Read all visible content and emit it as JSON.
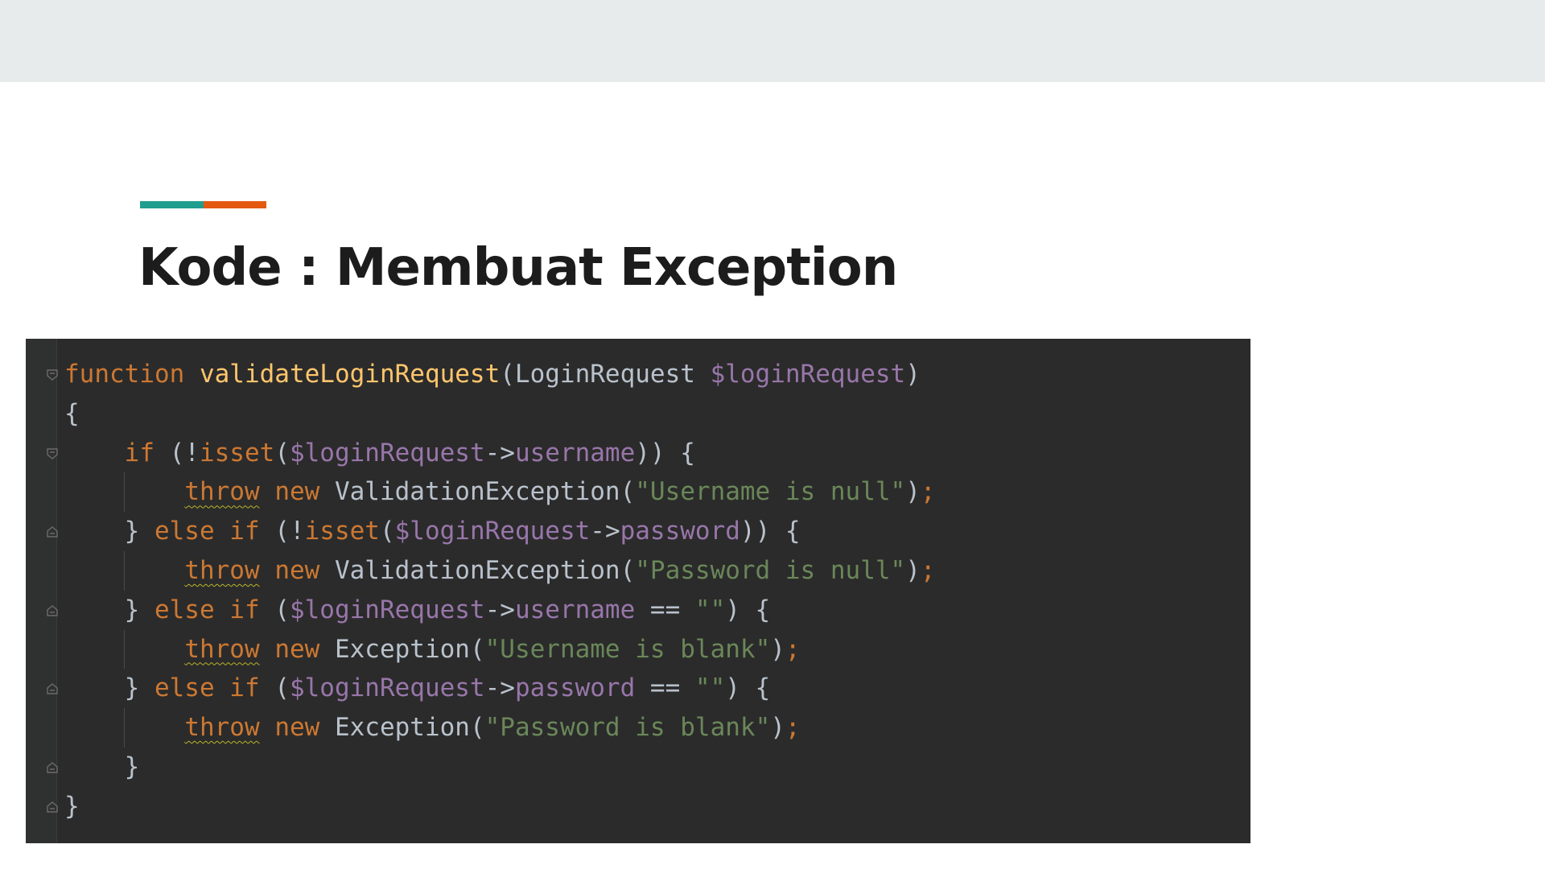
{
  "slide": {
    "title": "Kode : Membuat Exception",
    "accent_colors": [
      "#1f9e8f",
      "#e35a0f"
    ]
  },
  "code_panel": {
    "language": "php",
    "theme_colors": {
      "background": "#2b2b2b",
      "keyword": "#cc7832",
      "function_name": "#ffc66d",
      "variable": "#9876aa",
      "string": "#6a8759",
      "text": "#b9c2cc"
    },
    "lines": [
      [
        {
          "t": "function",
          "c": "kw"
        },
        {
          "t": " ",
          "c": "plain"
        },
        {
          "t": "validateLoginRequest",
          "c": "fn"
        },
        {
          "t": "(LoginRequest ",
          "c": "plain"
        },
        {
          "t": "$loginRequest",
          "c": "var"
        },
        {
          "t": ")",
          "c": "plain"
        }
      ],
      [
        {
          "t": "{",
          "c": "plain"
        }
      ],
      [
        {
          "t": "    ",
          "c": "plain"
        },
        {
          "t": "if",
          "c": "kw"
        },
        {
          "t": " (!",
          "c": "plain"
        },
        {
          "t": "isset",
          "c": "kw"
        },
        {
          "t": "(",
          "c": "plain"
        },
        {
          "t": "$loginRequest",
          "c": "var"
        },
        {
          "t": "->",
          "c": "plain"
        },
        {
          "t": "username",
          "c": "var"
        },
        {
          "t": ")) {",
          "c": "plain"
        }
      ],
      [
        {
          "t": "        ",
          "c": "plain"
        },
        {
          "t": "throw",
          "c": "throw"
        },
        {
          "t": " ",
          "c": "plain"
        },
        {
          "t": "new",
          "c": "kw"
        },
        {
          "t": " ValidationException(",
          "c": "plain"
        },
        {
          "t": "\"Username is null\"",
          "c": "str"
        },
        {
          "t": ")",
          "c": "plain"
        },
        {
          "t": ";",
          "c": "semi"
        }
      ],
      [
        {
          "t": "    } ",
          "c": "plain"
        },
        {
          "t": "else if",
          "c": "kw"
        },
        {
          "t": " (!",
          "c": "plain"
        },
        {
          "t": "isset",
          "c": "kw"
        },
        {
          "t": "(",
          "c": "plain"
        },
        {
          "t": "$loginRequest",
          "c": "var"
        },
        {
          "t": "->",
          "c": "plain"
        },
        {
          "t": "password",
          "c": "var"
        },
        {
          "t": ")) {",
          "c": "plain"
        }
      ],
      [
        {
          "t": "        ",
          "c": "plain"
        },
        {
          "t": "throw",
          "c": "throw"
        },
        {
          "t": " ",
          "c": "plain"
        },
        {
          "t": "new",
          "c": "kw"
        },
        {
          "t": " ValidationException(",
          "c": "plain"
        },
        {
          "t": "\"Password is null\"",
          "c": "str"
        },
        {
          "t": ")",
          "c": "plain"
        },
        {
          "t": ";",
          "c": "semi"
        }
      ],
      [
        {
          "t": "    } ",
          "c": "plain"
        },
        {
          "t": "else if",
          "c": "kw"
        },
        {
          "t": " (",
          "c": "plain"
        },
        {
          "t": "$loginRequest",
          "c": "var"
        },
        {
          "t": "->",
          "c": "plain"
        },
        {
          "t": "username",
          "c": "var"
        },
        {
          "t": " == ",
          "c": "plain"
        },
        {
          "t": "\"\"",
          "c": "str"
        },
        {
          "t": ") {",
          "c": "plain"
        }
      ],
      [
        {
          "t": "        ",
          "c": "plain"
        },
        {
          "t": "throw",
          "c": "throw"
        },
        {
          "t": " ",
          "c": "plain"
        },
        {
          "t": "new",
          "c": "kw"
        },
        {
          "t": " Exception(",
          "c": "plain"
        },
        {
          "t": "\"Username is blank\"",
          "c": "str"
        },
        {
          "t": ")",
          "c": "plain"
        },
        {
          "t": ";",
          "c": "semi"
        }
      ],
      [
        {
          "t": "    } ",
          "c": "plain"
        },
        {
          "t": "else if",
          "c": "kw"
        },
        {
          "t": " (",
          "c": "plain"
        },
        {
          "t": "$loginRequest",
          "c": "var"
        },
        {
          "t": "->",
          "c": "plain"
        },
        {
          "t": "password",
          "c": "var"
        },
        {
          "t": " == ",
          "c": "plain"
        },
        {
          "t": "\"\"",
          "c": "str"
        },
        {
          "t": ") {",
          "c": "plain"
        }
      ],
      [
        {
          "t": "        ",
          "c": "plain"
        },
        {
          "t": "throw",
          "c": "throw"
        },
        {
          "t": " ",
          "c": "plain"
        },
        {
          "t": "new",
          "c": "kw"
        },
        {
          "t": " Exception(",
          "c": "plain"
        },
        {
          "t": "\"Password is blank\"",
          "c": "str"
        },
        {
          "t": ")",
          "c": "plain"
        },
        {
          "t": ";",
          "c": "semi"
        }
      ],
      [
        {
          "t": "    }",
          "c": "plain"
        }
      ],
      [
        {
          "t": "}",
          "c": "plain"
        }
      ]
    ],
    "fold_markers": [
      {
        "line": 0,
        "icon": "fold-open-icon"
      },
      {
        "line": 2,
        "icon": "fold-open-icon"
      },
      {
        "line": 4,
        "icon": "fold-end-icon"
      },
      {
        "line": 6,
        "icon": "fold-end-icon"
      },
      {
        "line": 8,
        "icon": "fold-end-icon"
      },
      {
        "line": 10,
        "icon": "fold-end-icon"
      },
      {
        "line": 11,
        "icon": "fold-end-icon"
      }
    ],
    "indent_guide_lines": [
      3,
      5,
      7,
      9
    ]
  }
}
